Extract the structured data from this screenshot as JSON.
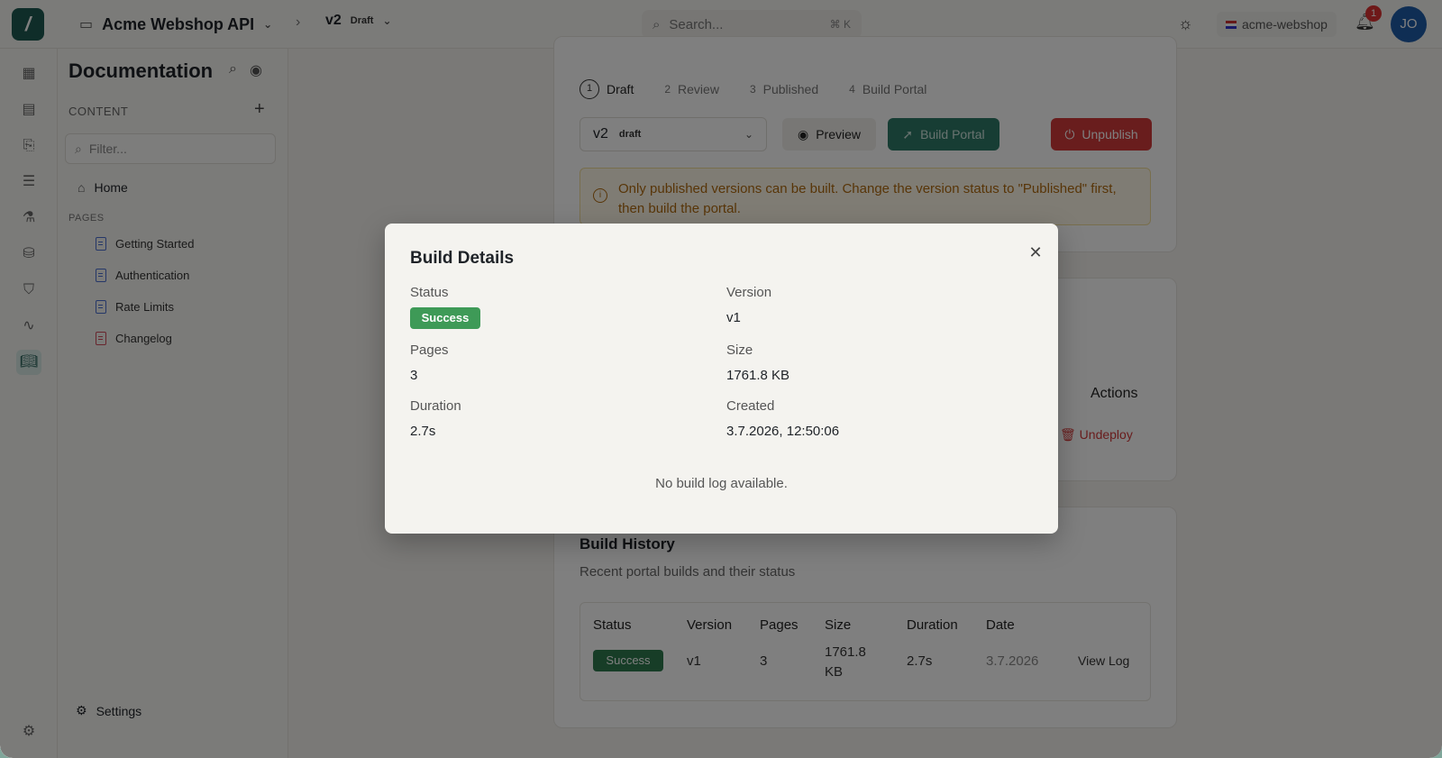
{
  "header": {
    "project_name": "Acme Webshop API",
    "version": "v2",
    "version_status": "Draft",
    "search_placeholder": "Search...",
    "search_shortcut": "⌘ K",
    "workspace": "acme-webshop",
    "notification_count": "1",
    "user_initials": "JO"
  },
  "sidebar": {
    "title": "Documentation",
    "content_label": "CONTENT",
    "filter_placeholder": "Filter...",
    "home_label": "Home",
    "pages_label": "PAGES",
    "pages": [
      {
        "label": "Getting Started"
      },
      {
        "label": "Authentication"
      },
      {
        "label": "Rate Limits"
      },
      {
        "label": "Changelog"
      }
    ],
    "settings_label": "Settings"
  },
  "publish": {
    "steps": [
      {
        "num": "1",
        "label": "Draft"
      },
      {
        "num": "2",
        "label": "Review"
      },
      {
        "num": "3",
        "label": "Published"
      },
      {
        "num": "4",
        "label": "Build Portal"
      }
    ],
    "version_select": "v2",
    "version_select_status": "draft",
    "preview_label": "Preview",
    "build_label": "Build Portal",
    "unpublish_label": "Unpublish",
    "warning": "Only published versions can be built. Change the version status to \"Published\" first, then build the portal."
  },
  "deployments": {
    "actions_header": "Actions",
    "undeploy_label": "Undeploy"
  },
  "build_history": {
    "title": "Build History",
    "subtitle": "Recent portal builds and their status",
    "columns": [
      "Status",
      "Version",
      "Pages",
      "Size",
      "Duration",
      "Date"
    ],
    "rows": [
      {
        "status": "Success",
        "version": "v1",
        "pages": "3",
        "size": "1761.8 KB",
        "duration": "2.7s",
        "date": "3.7.2026",
        "action": "View Log"
      }
    ]
  },
  "modal": {
    "title": "Build Details",
    "status_label": "Status",
    "status_value": "Success",
    "version_label": "Version",
    "version_value": "v1",
    "pages_label": "Pages",
    "pages_value": "3",
    "size_label": "Size",
    "size_value": "1761.8 KB",
    "duration_label": "Duration",
    "duration_value": "2.7s",
    "created_label": "Created",
    "created_value": "3.7.2026, 12:50:06",
    "log_text": "No build log available."
  },
  "colors": {
    "brand": "#1e5a52",
    "success": "#3e9a57",
    "danger": "#d33a3a",
    "warning": "#b06a10"
  }
}
